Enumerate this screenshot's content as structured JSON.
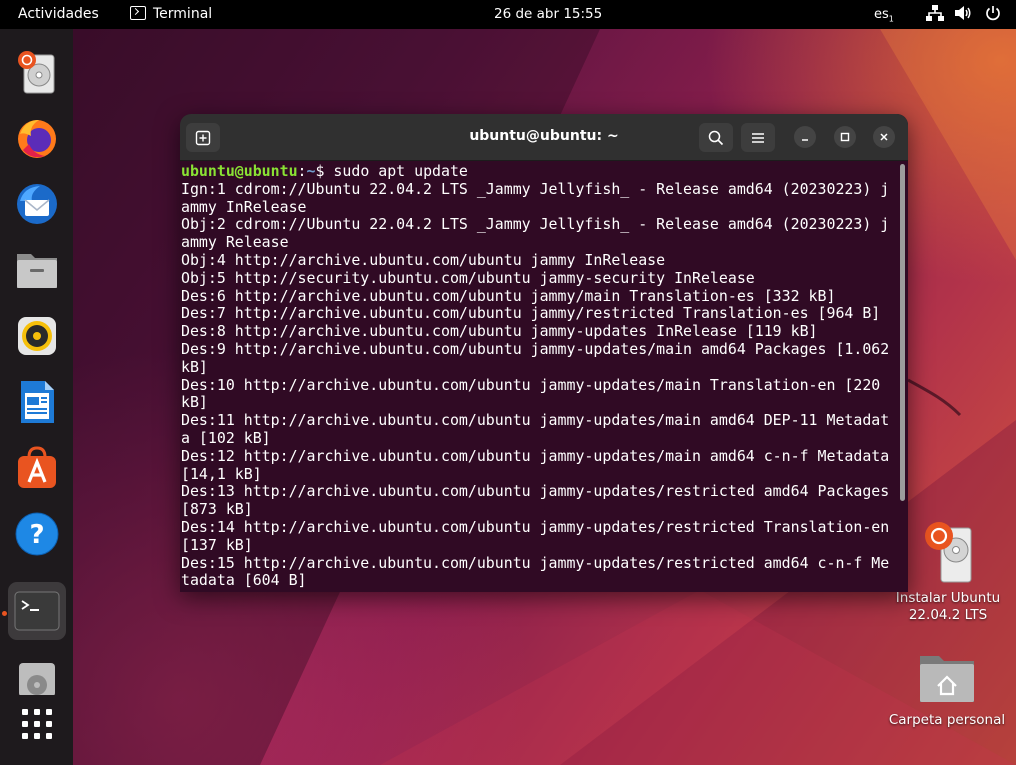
{
  "topbar": {
    "activities": "Actividades",
    "app_name": "Terminal",
    "clock": "26 de abr  15:55",
    "keyboard_layout": "es",
    "keyboard_layout_index": "1",
    "tray_icons": [
      "network-icon",
      "volume-icon",
      "power-icon"
    ]
  },
  "dock": {
    "items": [
      {
        "name": "install-ubuntu-icon",
        "running": false
      },
      {
        "name": "firefox-icon",
        "running": false
      },
      {
        "name": "thunderbird-icon",
        "running": false
      },
      {
        "name": "files-icon",
        "running": false
      },
      {
        "name": "rhythmbox-icon",
        "running": false
      },
      {
        "name": "libreoffice-writer-icon",
        "running": false
      },
      {
        "name": "ubuntu-software-icon",
        "running": false
      },
      {
        "name": "help-icon",
        "running": false
      },
      {
        "name": "terminal-icon",
        "running": true
      },
      {
        "name": "disc-icon",
        "running": false
      },
      {
        "name": "show-apps-icon",
        "running": false
      }
    ]
  },
  "desktop": {
    "icons": [
      {
        "label": "Instalar Ubuntu 22.04.2 LTS",
        "icon": "install-ubuntu-icon"
      },
      {
        "label": "Carpeta personal",
        "icon": "home-folder-icon"
      }
    ]
  },
  "terminal": {
    "title": "ubuntu@ubuntu: ~",
    "prompt_user": "ubuntu@ubuntu",
    "prompt_colon": ":",
    "prompt_path": "~",
    "prompt_symbol": "$",
    "command": " sudo apt update",
    "output": [
      "Ign:1 cdrom://Ubuntu 22.04.2 LTS _Jammy Jellyfish_ - Release amd64 (20230223) jammy InRelease",
      "Obj:2 cdrom://Ubuntu 22.04.2 LTS _Jammy Jellyfish_ - Release amd64 (20230223) jammy Release",
      "Obj:4 http://archive.ubuntu.com/ubuntu jammy InRelease",
      "Obj:5 http://security.ubuntu.com/ubuntu jammy-security InRelease",
      "Des:6 http://archive.ubuntu.com/ubuntu jammy/main Translation-es [332 kB]",
      "Des:7 http://archive.ubuntu.com/ubuntu jammy/restricted Translation-es [964 B]",
      "Des:8 http://archive.ubuntu.com/ubuntu jammy-updates InRelease [119 kB]",
      "Des:9 http://archive.ubuntu.com/ubuntu jammy-updates/main amd64 Packages [1.062 kB]",
      "Des:10 http://archive.ubuntu.com/ubuntu jammy-updates/main Translation-en [220 kB]",
      "Des:11 http://archive.ubuntu.com/ubuntu jammy-updates/main amd64 DEP-11 Metadata [102 kB]",
      "Des:12 http://archive.ubuntu.com/ubuntu jammy-updates/main amd64 c-n-f Metadata [14,1 kB]",
      "Des:13 http://archive.ubuntu.com/ubuntu jammy-updates/restricted amd64 Packages [873 kB]",
      "Des:14 http://archive.ubuntu.com/ubuntu jammy-updates/restricted Translation-en [137 kB]",
      "Des:15 http://archive.ubuntu.com/ubuntu jammy-updates/restricted amd64 c-n-f Metadata [604 B]"
    ]
  },
  "colors": {
    "terminal_bg": "#300a24",
    "prompt_user": "#8ae234",
    "prompt_path": "#729fcf",
    "accent": "#e95420",
    "topbar_bg": "#000000",
    "dock_bg": "#1e1a1d"
  }
}
